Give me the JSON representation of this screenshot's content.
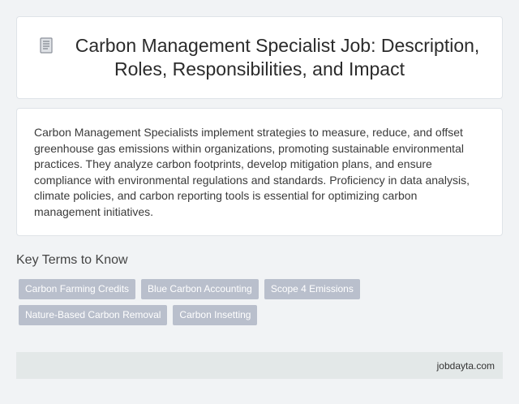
{
  "header": {
    "icon": "document-icon",
    "title": "Carbon Management Specialist Job: Description, Roles, Responsibilities, and Impact"
  },
  "description": "Carbon Management Specialists implement strategies to measure, reduce, and offset greenhouse gas emissions within organizations, promoting sustainable environmental practices. They analyze carbon footprints, develop mitigation plans, and ensure compliance with environmental regulations and standards. Proficiency in data analysis, climate policies, and carbon reporting tools is essential for optimizing carbon management initiatives.",
  "key_terms": {
    "heading": "Key Terms to Know",
    "items": [
      "Carbon Farming Credits",
      "Blue Carbon Accounting",
      "Scope 4 Emissions",
      "Nature-Based Carbon Removal",
      "Carbon Insetting"
    ]
  },
  "footer": {
    "site": "jobdayta.com"
  },
  "colors": {
    "tag_background": "#b9bfcc",
    "footer_background": "#e3e8e8",
    "page_background": "#f1f3f5"
  }
}
